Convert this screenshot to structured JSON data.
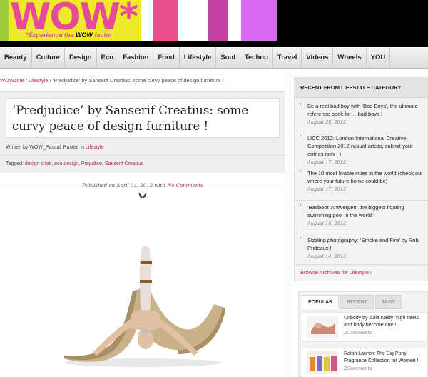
{
  "header": {
    "logo": "WOW",
    "logo_star": "*",
    "tagline_prefix": "*Experience the ",
    "tagline_bold": "WOW",
    "tagline_suffix": " factor",
    "colors": {
      "logo_bg": "#f0ea2a",
      "logo_text": "#e64a9a",
      "bar_pink": "#e94f8d",
      "bar_magenta": "#c63fa2",
      "bar_purple": "#b23fd1",
      "bar_violet": "#d868f0"
    }
  },
  "nav": {
    "items": [
      "Beauty",
      "Culture",
      "Design",
      "Eco",
      "Fashion",
      "Food",
      "Lifestyle",
      "Soul",
      "Techno",
      "Travel",
      "Videos",
      "Wheels",
      "YOU"
    ]
  },
  "breadcrumb": {
    "home": "WOWzine",
    "sep1": " / ",
    "category": "Lifestyle",
    "sep2": " / ",
    "current": "‘Predjudice’ by Sanserif Creatius: some curvy peace of design furniture !"
  },
  "post": {
    "title": "‘Predjudice’ by Sanserif Creatius: some curvy peace of design furniture !",
    "written_by": "Written by WOW_Pascal. Posted in ",
    "posted_in": "Lifestyle",
    "tags_label": "Tagged: ",
    "tags": [
      "design chair",
      "eco design",
      "Prejudice",
      "Sanserif Creatius"
    ],
    "published_prefix": "Published on April 04, 2012 with ",
    "comments_link": "No Comments"
  },
  "sidebar": {
    "recent_heading": "RECENT FROM LIFESTYLE CATEGORY",
    "recent": [
      {
        "text": "Be a real bad boy with ‘Bad Boys’, the ultimate reference book for… bad boys !",
        "date": "August 20, 2012"
      },
      {
        "text": "LICC 2012: London International Creative Competition 2012 (visual artists, submit your entries now ! )",
        "date": "August 17, 2012"
      },
      {
        "text": "The 10 most livable cities in the world (check out where your future home could be)",
        "date": "August 17, 2012"
      },
      {
        "text": "‘Badboot’ Antwerpen: the biggest floating swimming pool in the world !",
        "date": "August 16, 2012"
      },
      {
        "text": "Sizzling photography: ‘Smoke and Fire’ by Rob Prideaux !",
        "date": "August 14, 2012"
      }
    ],
    "browse": "Browse Archives for Lifestyle",
    "tabs": [
      "POPULAR",
      "RECENT",
      "TAGS"
    ],
    "popular": [
      {
        "title": "Unbody by Julia Kaldy: high heels and body become one !",
        "comments": "2Comments"
      },
      {
        "title": "Ralph Lauren: The Big Pony Fragrance Collection for Women !",
        "comments": "2Comments"
      }
    ]
  }
}
